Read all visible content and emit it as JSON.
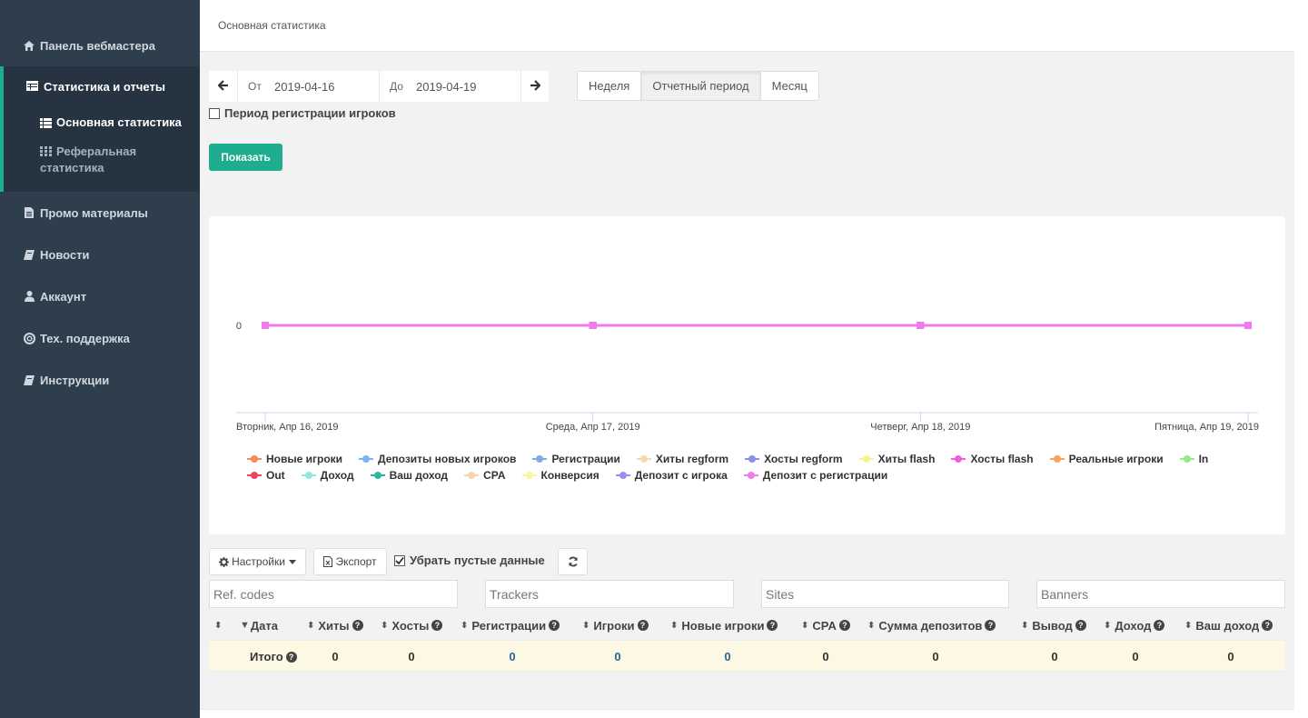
{
  "sidebar": {
    "items": [
      {
        "label": "Панель вебмастера",
        "icon": "home-icon"
      },
      {
        "label": "Статистика и отчеты",
        "icon": "table-icon"
      },
      {
        "label": "Промо материалы",
        "icon": "file-icon"
      },
      {
        "label": "Новости",
        "icon": "book-icon"
      },
      {
        "label": "Аккаунт",
        "icon": "user-icon"
      },
      {
        "label": "Тех. поддержка",
        "icon": "lifebuoy-icon"
      },
      {
        "label": "Инструкции",
        "icon": "book-icon"
      }
    ],
    "subitems": [
      {
        "label": "Основная статистика",
        "icon": "list-icon"
      },
      {
        "label": "Реферальная статистика",
        "icon": "grid-icon"
      }
    ],
    "accent": "#1eae8f"
  },
  "header": {
    "breadcrumb": "Основная статистика"
  },
  "filters": {
    "from_label": "От",
    "from_value": "2019-04-16",
    "to_label": "До",
    "to_value": "2019-04-19",
    "periods": [
      "Неделя",
      "Отчетный период",
      "Месяц"
    ],
    "active_period": "Отчетный период",
    "reg_period_label": "Период регистрации игроков",
    "reg_period_checked": false,
    "show_button": "Показать"
  },
  "chart_data": {
    "type": "line",
    "x": [
      "Вторник, Апр 16, 2019",
      "Среда, Апр 17, 2019",
      "Четверг, Апр 18, 2019",
      "Пятница, Апр 19, 2019"
    ],
    "y_ticks": [
      "0"
    ],
    "series": [
      {
        "name": "Новые игроки",
        "values": [
          0,
          0,
          0,
          0
        ],
        "color": "#f58b55"
      },
      {
        "name": "Депозиты новых игроков",
        "values": [
          0,
          0,
          0,
          0
        ],
        "color": "#7cb5ec"
      },
      {
        "name": "Регистрации",
        "values": [
          0,
          0,
          0,
          0
        ],
        "color": "#7cace3"
      },
      {
        "name": "Хиты regform",
        "values": [
          0,
          0,
          0,
          0
        ],
        "color": "#f7d8a8"
      },
      {
        "name": "Хосты regform",
        "values": [
          0,
          0,
          0,
          0
        ],
        "color": "#8f8fe8"
      },
      {
        "name": "Хиты flash",
        "values": [
          0,
          0,
          0,
          0
        ],
        "color": "#f7f48d"
      },
      {
        "name": "Хосты flash",
        "values": [
          0,
          0,
          0,
          0
        ],
        "color": "#ee5fe0"
      },
      {
        "name": "Реальные игроки",
        "values": [
          0,
          0,
          0,
          0
        ],
        "color": "#f7a35c"
      },
      {
        "name": "In",
        "values": [
          0,
          0,
          0,
          0
        ],
        "color": "#90ed7d"
      },
      {
        "name": "Out",
        "values": [
          0,
          0,
          0,
          0
        ],
        "color": "#f0435e"
      },
      {
        "name": "Доход",
        "values": [
          0,
          0,
          0,
          0
        ],
        "color": "#91e8e1"
      },
      {
        "name": "Ваш доход",
        "values": [
          0,
          0,
          0,
          0
        ],
        "color": "#2ab69e"
      },
      {
        "name": "CPA",
        "values": [
          0,
          0,
          0,
          0
        ],
        "color": "#f8d5a6"
      },
      {
        "name": "Конверсия",
        "values": [
          0,
          0,
          0,
          0
        ],
        "color": "#f7f7a0"
      },
      {
        "name": "Депозит с игрока",
        "values": [
          0,
          0,
          0,
          0
        ],
        "color": "#9a8ff0"
      },
      {
        "name": "Депозит с регистрации",
        "values": [
          0,
          0,
          0,
          0
        ],
        "color": "#ef7af0"
      }
    ]
  },
  "toolbar": {
    "settings_label": "Настройки",
    "export_label": "Экспорт",
    "hide_empty_label": "Убрать пустые данные",
    "hide_empty_checked": true
  },
  "filter_inputs": [
    "Ref. codes",
    "Trackers",
    "Sites",
    "Banners"
  ],
  "table": {
    "columns": [
      "Дата",
      "Хиты",
      "Хосты",
      "Регистрации",
      "Игроки",
      "Новые игроки",
      "CPA",
      "Сумма депозитов",
      "Вывод",
      "Доход",
      "Ваш доход"
    ],
    "total_label": "Итого",
    "total_values": [
      "0",
      "0",
      "0",
      "0",
      "0",
      "0",
      "0",
      "0",
      "0",
      "0"
    ]
  }
}
